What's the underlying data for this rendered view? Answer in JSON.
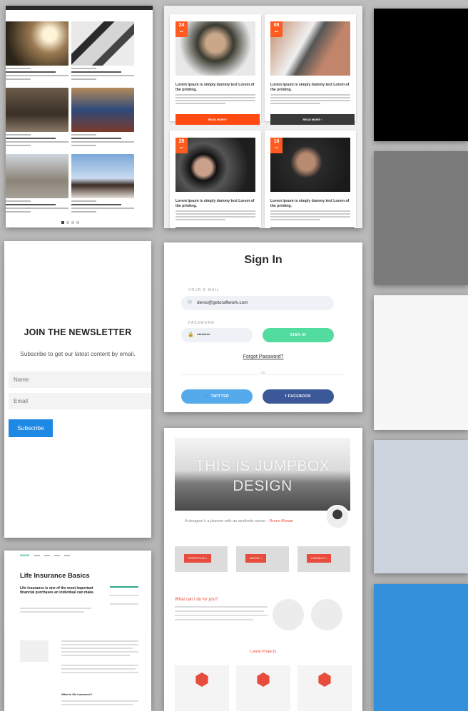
{
  "swatches": [
    {
      "name": "black",
      "color": "#000000"
    },
    {
      "name": "gray",
      "color": "#7b7b7b"
    },
    {
      "name": "off-white",
      "color": "#f7f7f7"
    },
    {
      "name": "light-blue-gray",
      "color": "#cdd3dc"
    },
    {
      "name": "blue",
      "color": "#3490db"
    }
  ],
  "blog": {
    "posts": [
      {
        "day": "24",
        "month": "Mar",
        "title": "Lorem Ipsum is simply dummy text Lorem of the printing.",
        "button": "READ MORE",
        "accent": "#ff4a12"
      },
      {
        "day": "08",
        "month": "Mar",
        "title": "Lorem Ipsum is simply dummy text Lorem of the printing.",
        "button": "READ MORE",
        "accent": "#3a3a3a"
      },
      {
        "day": "20",
        "month": "Mar",
        "title": "Lorem Ipsum is simply dummy text Lorem of the printing."
      },
      {
        "day": "16",
        "month": "Feb",
        "title": "Lorem Ipsum is simply dummy text Lorem of the printing."
      }
    ]
  },
  "newsletter": {
    "title": "JOIN THE NEWSLETTER",
    "subtitle": "Subscribe to get our latest content by email.",
    "name_placeholder": "Name",
    "email_placeholder": "Email",
    "button": "Subscribe"
  },
  "signin": {
    "title": "Sign In",
    "email_label": "YOUR E-MAIL",
    "email_value": "denis@getcraftwork.com",
    "password_label": "PASSWORD",
    "password_value": "••••••••",
    "signin_button": "SIGN IN",
    "forgot": "Forgot Password?",
    "or": "OR",
    "twitter": "TWITTER",
    "facebook": "FACEBOOK"
  },
  "jumpbox": {
    "hero_line1": "THIS IS JUMPBOX",
    "hero_line2": "DESIGN",
    "tagline": "A designer's a planner with an aesthetic sense –",
    "tagline_author": "Bruno Munari",
    "tiles": [
      "PORTFOLIO »",
      "ABOUT »",
      "CONTACT »"
    ],
    "what_heading": "What can I do for you?",
    "latest_projects": "Latest Projects"
  },
  "insurance": {
    "brand": "INSURE",
    "title": "Life Insurance Basics",
    "intro": "Life insurance is one of the most important financial purchases an individual can make.",
    "subheading": "What is life insurance?"
  }
}
